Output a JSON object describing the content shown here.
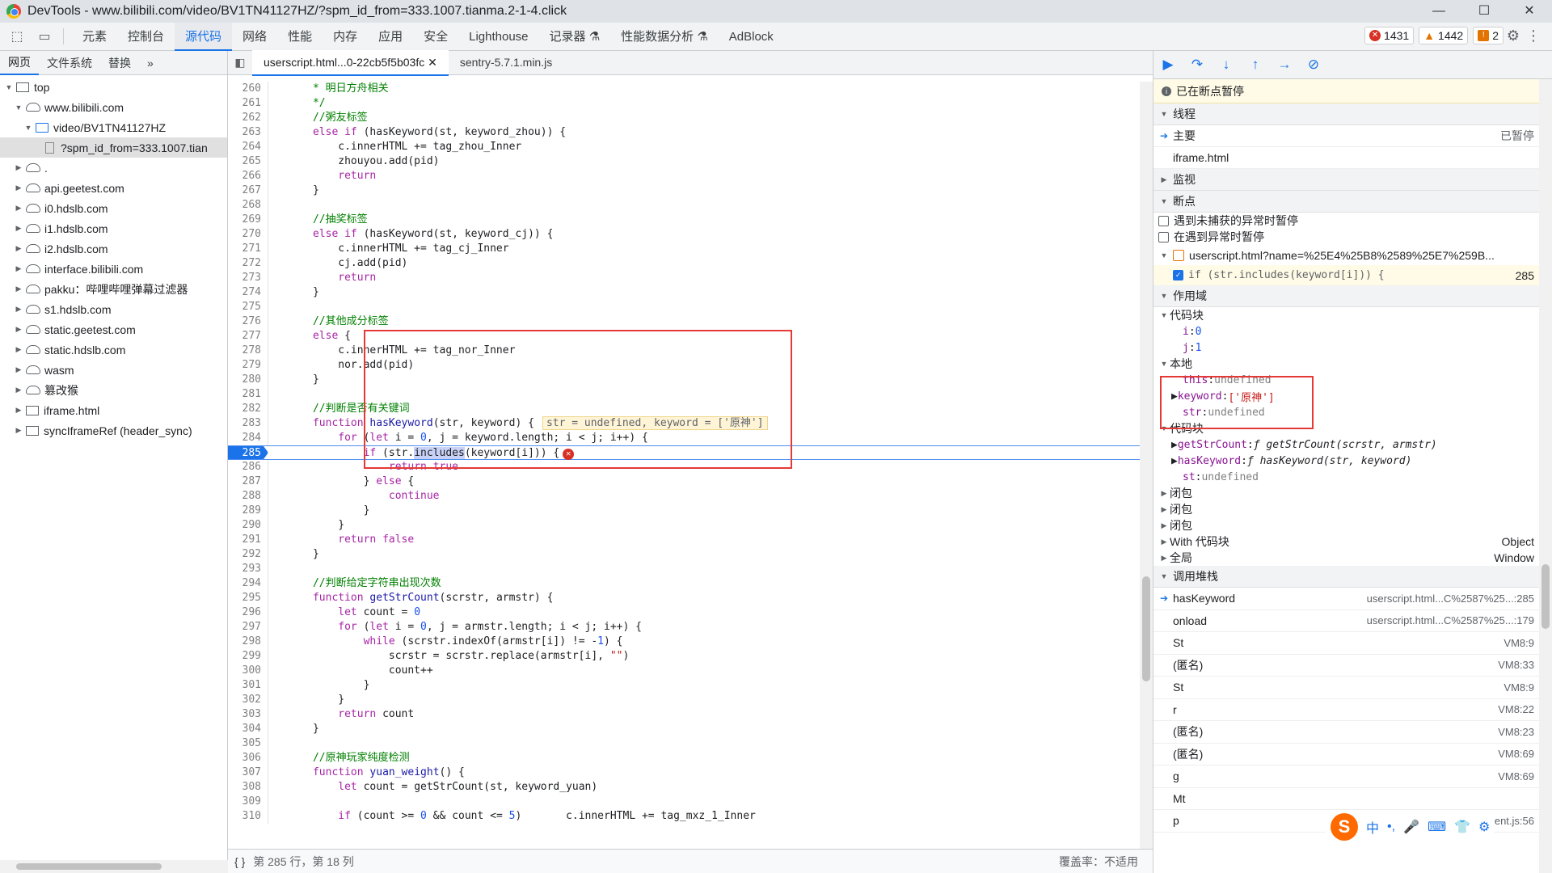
{
  "window": {
    "title": "DevTools - www.bilibili.com/video/BV1TN41127HZ/?spm_id_from=333.1007.tianma.2-1-4.click"
  },
  "panel_tabs": [
    "元素",
    "控制台",
    "源代码",
    "网络",
    "性能",
    "内存",
    "应用",
    "安全",
    "Lighthouse",
    "记录器 ⚗",
    "性能数据分析 ⚗",
    "AdBlock"
  ],
  "counts": {
    "errors": "1431",
    "warnings": "1442",
    "issues": "2"
  },
  "left": {
    "tabs": [
      "网页",
      "文件系统",
      "替换",
      "»"
    ],
    "tree": [
      {
        "label": "top",
        "level": 0,
        "icon": "frame",
        "open": true
      },
      {
        "label": "www.bilibili.com",
        "level": 1,
        "icon": "cloud",
        "open": true
      },
      {
        "label": "video/BV1TN41127HZ",
        "level": 2,
        "icon": "folder",
        "open": true
      },
      {
        "label": "?spm_id_from=333.1007.tian",
        "level": 3,
        "icon": "file",
        "sel": true
      },
      {
        "label": ".",
        "level": 1,
        "icon": "cloud"
      },
      {
        "label": "api.geetest.com",
        "level": 1,
        "icon": "cloud"
      },
      {
        "label": "i0.hdslb.com",
        "level": 1,
        "icon": "cloud"
      },
      {
        "label": "i1.hdslb.com",
        "level": 1,
        "icon": "cloud"
      },
      {
        "label": "i2.hdslb.com",
        "level": 1,
        "icon": "cloud"
      },
      {
        "label": "interface.bilibili.com",
        "level": 1,
        "icon": "cloud"
      },
      {
        "label": "pakku：哔哩哔哩弹幕过滤器",
        "level": 1,
        "icon": "cloud"
      },
      {
        "label": "s1.hdslb.com",
        "level": 1,
        "icon": "cloud"
      },
      {
        "label": "static.geetest.com",
        "level": 1,
        "icon": "cloud"
      },
      {
        "label": "static.hdslb.com",
        "level": 1,
        "icon": "cloud"
      },
      {
        "label": "wasm",
        "level": 1,
        "icon": "cloud"
      },
      {
        "label": "篡改猴",
        "level": 1,
        "icon": "cloud"
      },
      {
        "label": "iframe.html",
        "level": 1,
        "icon": "frame"
      },
      {
        "label": "syncIframeRef (header_sync)",
        "level": 1,
        "icon": "frame"
      }
    ]
  },
  "editor": {
    "tabs": [
      {
        "label": "userscript.html...0-22cb5f5b03fc",
        "active": true
      },
      {
        "label": "sentry-5.7.1.min.js",
        "active": false
      }
    ],
    "status_pos": "第 285 行，第 18 列",
    "coverage": "覆盖率：不适用",
    "lines": [
      {
        "n": 260,
        "html": "      <span class='cm'>* 明日方舟相关</span>"
      },
      {
        "n": 261,
        "html": "      <span class='cm'>*/</span>"
      },
      {
        "n": 262,
        "html": "      <span class='cm'>//粥友标签</span>"
      },
      {
        "n": 263,
        "html": "      <span class='kw'>else if</span> (hasKeyword(st, keyword_zhou)) {"
      },
      {
        "n": 264,
        "html": "          c.innerHTML += tag_zhou_Inner"
      },
      {
        "n": 265,
        "html": "          zhouyou.add(pid)"
      },
      {
        "n": 266,
        "html": "          <span class='kw'>return</span>"
      },
      {
        "n": 267,
        "html": "      }"
      },
      {
        "n": 268,
        "html": ""
      },
      {
        "n": 269,
        "html": "      <span class='cm'>//抽奖标签</span>"
      },
      {
        "n": 270,
        "html": "      <span class='kw'>else if</span> (hasKeyword(st, keyword_cj)) {"
      },
      {
        "n": 271,
        "html": "          c.innerHTML += tag_cj_Inner"
      },
      {
        "n": 272,
        "html": "          cj.add(pid)"
      },
      {
        "n": 273,
        "html": "          <span class='kw'>return</span>"
      },
      {
        "n": 274,
        "html": "      }"
      },
      {
        "n": 275,
        "html": ""
      },
      {
        "n": 276,
        "html": "      <span class='cm'>//其他成分标签</span>"
      },
      {
        "n": 277,
        "html": "      <span class='kw'>else</span> {"
      },
      {
        "n": 278,
        "html": "          c.innerHTML += tag_nor_Inner"
      },
      {
        "n": 279,
        "html": "          nor.add(pid)"
      },
      {
        "n": 280,
        "html": "      }"
      },
      {
        "n": 281,
        "html": ""
      },
      {
        "n": 282,
        "html": "      <span class='cm'>//判断是否有关键词</span>"
      },
      {
        "n": 283,
        "html": "      <span class='kw'>function</span> <span class='fn'>hasKeyword</span>(str, keyword) {<span class='inl'>str = undefined, keyword = ['原神']</span>"
      },
      {
        "n": 284,
        "html": "          <span class='kw'>for</span> (<span class='kw'>let</span> i = <span class='num'>0</span>, j = keyword.length; i &lt; j; i++) {"
      },
      {
        "n": 285,
        "html": "              <span class='kw'>if</span> (str.<span class='hl'>includes</span>(keyword[i])) {<span class='erricon'>✕</span>",
        "bp": true
      },
      {
        "n": 286,
        "html": "                  <span class='kw'>return</span> <span class='kw'>true</span>"
      },
      {
        "n": 287,
        "html": "              } <span class='kw'>else</span> {"
      },
      {
        "n": 288,
        "html": "                  <span class='kw'>continue</span>"
      },
      {
        "n": 289,
        "html": "              }"
      },
      {
        "n": 290,
        "html": "          }"
      },
      {
        "n": 291,
        "html": "          <span class='kw'>return</span> <span class='kw'>false</span>"
      },
      {
        "n": 292,
        "html": "      }"
      },
      {
        "n": 293,
        "html": ""
      },
      {
        "n": 294,
        "html": "      <span class='cm'>//判断给定字符串出现次数</span>"
      },
      {
        "n": 295,
        "html": "      <span class='kw'>function</span> <span class='fn'>getStrCount</span>(scrstr, armstr) {"
      },
      {
        "n": 296,
        "html": "          <span class='kw'>let</span> count = <span class='num'>0</span>"
      },
      {
        "n": 297,
        "html": "          <span class='kw'>for</span> (<span class='kw'>let</span> i = <span class='num'>0</span>, j = armstr.length; i &lt; j; i++) {"
      },
      {
        "n": 298,
        "html": "              <span class='kw'>while</span> (scrstr.indexOf(armstr[i]) != -<span class='num'>1</span>) {"
      },
      {
        "n": 299,
        "html": "                  scrstr = scrstr.replace(armstr[i], <span class='str'>\"\"</span>)"
      },
      {
        "n": 300,
        "html": "                  count++"
      },
      {
        "n": 301,
        "html": "              }"
      },
      {
        "n": 302,
        "html": "          }"
      },
      {
        "n": 303,
        "html": "          <span class='kw'>return</span> count"
      },
      {
        "n": 304,
        "html": "      }"
      },
      {
        "n": 305,
        "html": ""
      },
      {
        "n": 306,
        "html": "      <span class='cm'>//原神玩家纯度检测</span>"
      },
      {
        "n": 307,
        "html": "      <span class='kw'>function</span> <span class='fn'>yuan_weight</span>() {"
      },
      {
        "n": 308,
        "html": "          <span class='kw'>let</span> count = getStrCount(st, keyword_yuan)"
      },
      {
        "n": 309,
        "html": ""
      },
      {
        "n": 310,
        "html": "          <span class='kw'>if</span> (count &gt;= <span class='num'>0</span> &amp;&amp; count &lt;= <span class='num'>5</span>)       c.innerHTML += tag_mxz_1_Inner"
      }
    ]
  },
  "right": {
    "paused": "已在断点暂停",
    "threads_label": "线程",
    "threads": [
      {
        "label": "主要",
        "status": "已暂停",
        "arrow": true
      },
      {
        "label": "iframe.html",
        "status": ""
      }
    ],
    "watch_label": "监视",
    "breakpoints_label": "断点",
    "bp_opts": [
      "遇到未捕获的异常时暂停",
      "在遇到异常时暂停"
    ],
    "bp_file": "userscript.html?name=%25E4%25B8%2589%25E7%259B...",
    "bp_line": "if (str.includes(keyword[i])) {",
    "bp_line_no": "285",
    "scope_label": "作用域",
    "scope_block1": "代码块",
    "scope_block1_vars": [
      {
        "k": "i",
        "v": "0"
      },
      {
        "k": "j",
        "v": "1"
      }
    ],
    "local_label": "本地",
    "local_vars": [
      {
        "k": "this",
        "v": "undefined",
        "type": "u"
      },
      {
        "k": "keyword",
        "v": "['原神']",
        "type": "s"
      },
      {
        "k": "str",
        "v": "undefined",
        "type": "u"
      }
    ],
    "scope_block2": "代码块",
    "block2_vars": [
      {
        "k": "getStrCount",
        "v": "ƒ getStrCount(scrstr, armstr)",
        "type": "f"
      },
      {
        "k": "hasKeyword",
        "v": "ƒ hasKeyword(str, keyword)",
        "type": "f"
      },
      {
        "k": "st",
        "v": "undefined",
        "type": "u"
      }
    ],
    "closures": [
      "闭包",
      "闭包",
      "闭包"
    ],
    "with_block": "With 代码块",
    "with_val": "Object",
    "global": "全局",
    "global_val": "Window",
    "callstack_label": "调用堆栈",
    "callstack": [
      {
        "fn": "hasKeyword",
        "loc": "userscript.html...C%2587%25...:285",
        "arrow": true
      },
      {
        "fn": "onload",
        "loc": "userscript.html...C%2587%25...:179"
      },
      {
        "fn": "St",
        "loc": "VM8:9"
      },
      {
        "fn": "(匿名)",
        "loc": "VM8:33"
      },
      {
        "fn": "St",
        "loc": "VM8:9"
      },
      {
        "fn": "r",
        "loc": "VM8:22"
      },
      {
        "fn": "(匿名)",
        "loc": "VM8:23"
      },
      {
        "fn": "(匿名)",
        "loc": "VM8:69"
      },
      {
        "fn": "g",
        "loc": "VM8:69"
      },
      {
        "fn": "Mt",
        "loc": ""
      },
      {
        "fn": "p",
        "loc": "VM6 content.js:56"
      }
    ]
  },
  "ime": {
    "logo": "S",
    "lang": "中"
  }
}
